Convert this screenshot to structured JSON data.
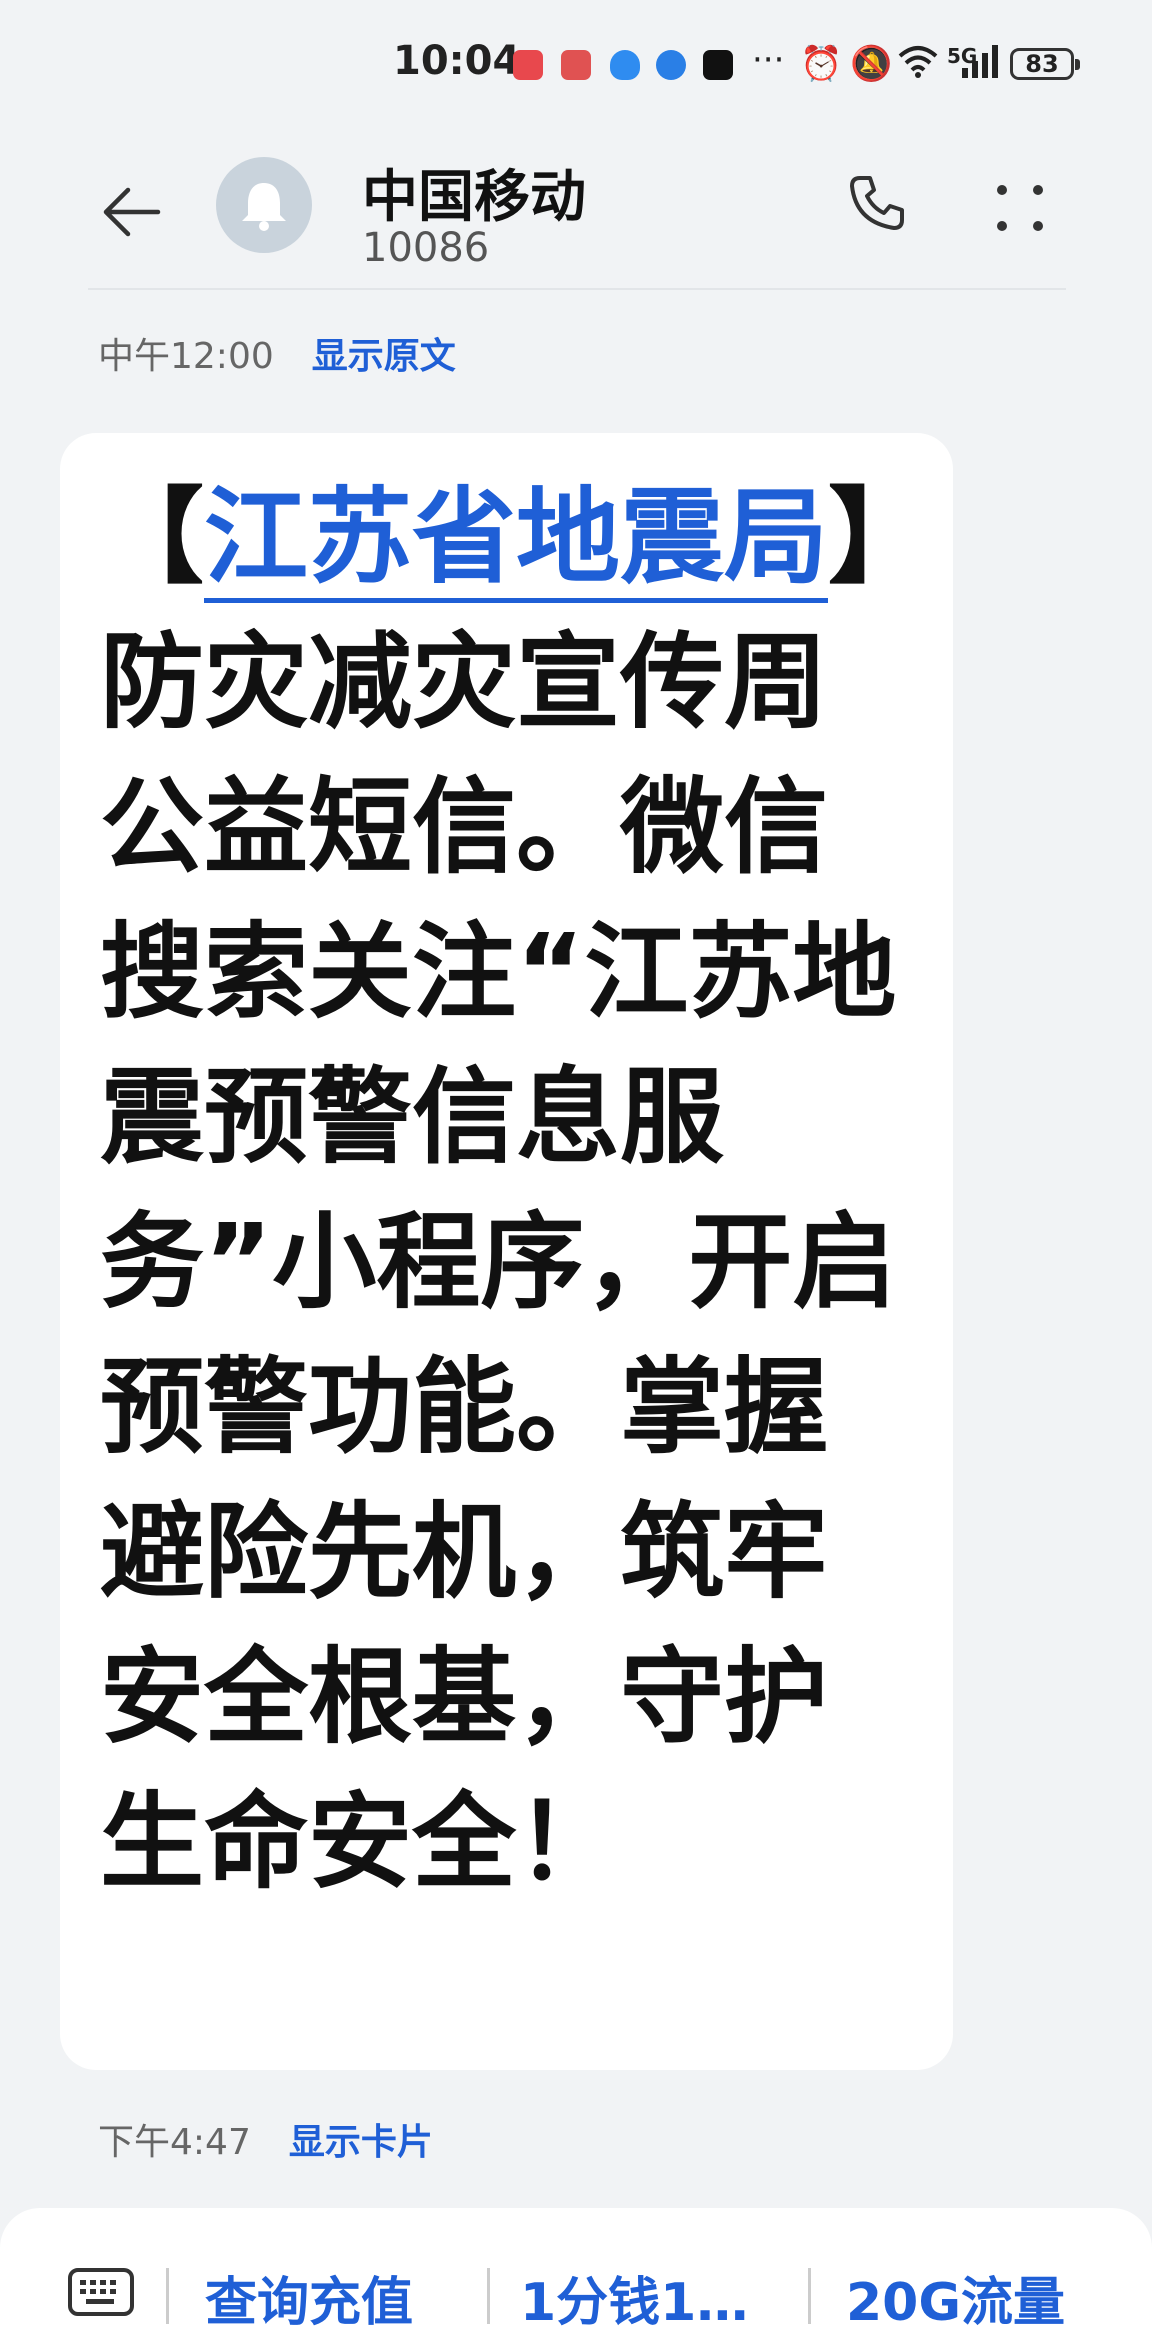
{
  "status_bar": {
    "time": "10:04",
    "network": "5G",
    "battery": "83",
    "more": "···"
  },
  "header": {
    "contact_name": "中国移动",
    "contact_number": "10086",
    "icons": [
      "back-arrow-icon",
      "bell-icon",
      "phone-icon",
      "more-dots-icon"
    ]
  },
  "messages": [
    {
      "time": "中午12:00",
      "action": "显示原文",
      "highlight": "江苏省地震局",
      "text_before": "【",
      "text_after": "】防灾减灾宣传周公益短信。微信搜索关注“江苏地震预警信息服务”小程序，开启预警功能。掌握避险先机，筑牢安全根基，守护生命安全！"
    },
    {
      "time": "下午4:47",
      "action": "显示卡片"
    }
  ],
  "quick_replies": [
    "查询充值",
    "1分钱1…",
    "20G流量"
  ],
  "colors": {
    "accent": "#1f5fd6",
    "background": "#f1f3f5",
    "bubble": "#ffffff"
  }
}
